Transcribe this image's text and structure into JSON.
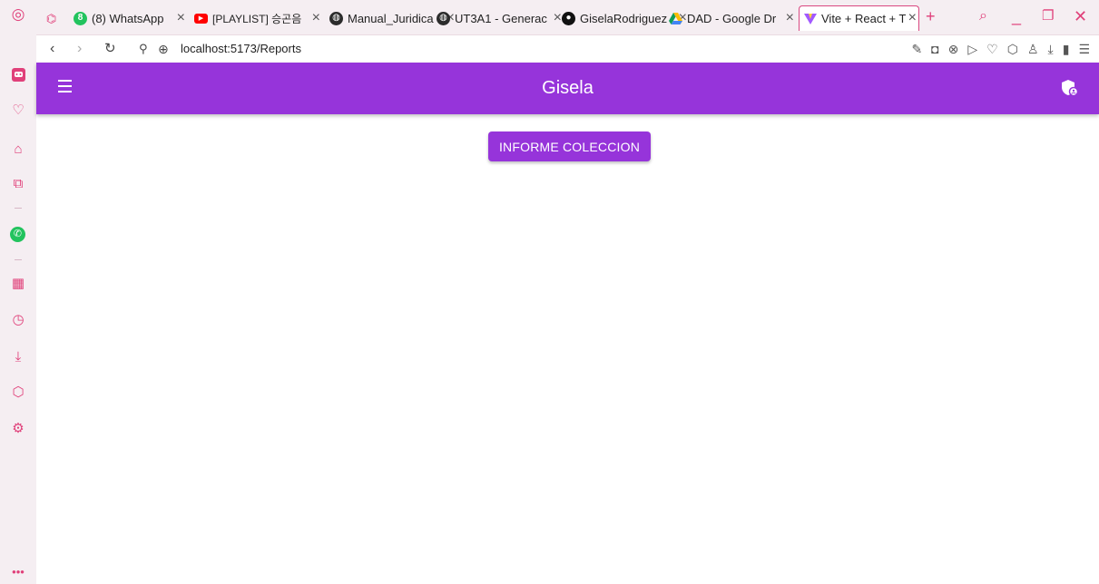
{
  "browser": {
    "tabs": [
      {
        "title": "(8) WhatsApp",
        "icon": "whatsapp-icon",
        "badge": "8"
      },
      {
        "title": "[PLAYLIST] 승곤음",
        "icon": "youtube-icon"
      },
      {
        "title": "Manual_Juridica",
        "icon": "globe-icon"
      },
      {
        "title": "UT3A1 - Generac",
        "icon": "globe-icon"
      },
      {
        "title": "GiselaRodriguez",
        "icon": "github-icon"
      },
      {
        "title": "DAD - Google Dr",
        "icon": "google-drive-icon"
      },
      {
        "title": "Vite + React + TS",
        "icon": "vite-icon",
        "active": true
      }
    ],
    "url": "localhost:5173/Reports"
  },
  "app": {
    "title": "Gisela",
    "report_button": "INFORME COLECCION",
    "accent_color": "#9634da"
  }
}
